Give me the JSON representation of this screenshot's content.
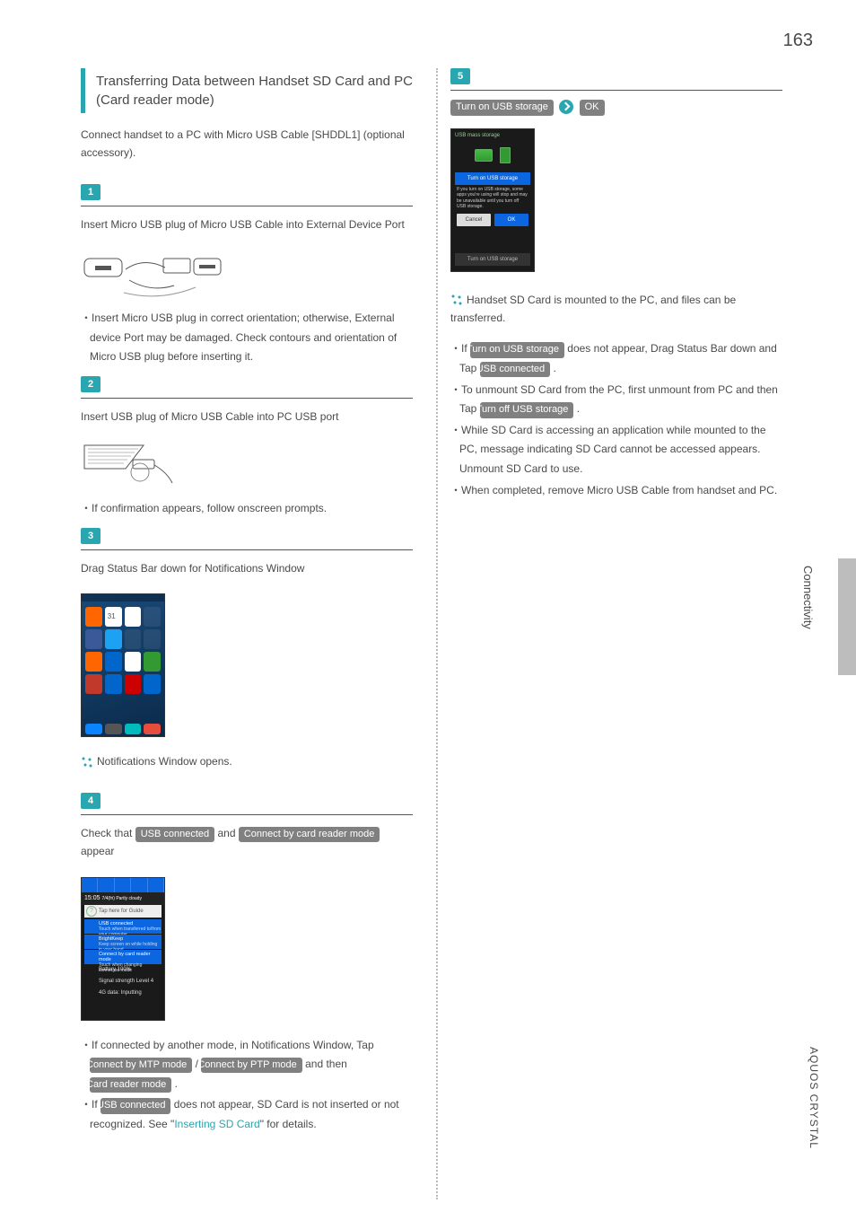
{
  "page_number": "163",
  "side_tab": "Connectivity",
  "footer_side": "AQUOS CRYSTAL",
  "left": {
    "title": "Transferring Data between Handset SD Card and PC (Card reader mode)",
    "intro": "Connect handset to a PC with Micro USB Cable [SHDDL1] (optional accessory).",
    "s1": {
      "num": "1",
      "text": "Insert Micro USB plug of Micro USB Cable into External Device Port",
      "note": "Insert Micro USB plug in correct orientation; otherwise, External device Port may be damaged. Check contours and orientation of Micro USB plug before inserting it."
    },
    "s2": {
      "num": "2",
      "text": "Insert USB plug of Micro USB Cable into PC USB port",
      "note": "If confirmation appears, follow onscreen prompts."
    },
    "s3": {
      "num": "3",
      "text": "Drag Status Bar down for Notifications Window",
      "result": "Notifications Window opens."
    },
    "s4": {
      "num": "4",
      "pre": "Check that ",
      "btn1": "USB connected",
      "mid": " and ",
      "btn2": "Connect by card reader mode",
      "post": " appear",
      "note1_a": "If connected by another mode, in Notifications Window, Tap ",
      "note1_btn1": "Connect by MTP mode",
      "note1_sep": " / ",
      "note1_btn2": "Connect by PTP mode",
      "note1_b": " and then ",
      "note1_btn3": "Card reader mode",
      "note1_c": " .",
      "note2_a": "If ",
      "note2_btn": "USB connected",
      "note2_b": " does not appear, SD Card is not inserted or not recognized. See \"",
      "note2_link": "Inserting SD Card",
      "note2_c": "\" for details."
    }
  },
  "right": {
    "s5": {
      "num": "5",
      "btn1": "Turn on USB storage",
      "btn2": "OK",
      "result": "Handset SD Card is mounted to the PC, and files can be transferred.",
      "n1_a": "If ",
      "n1_btn": "Turn on USB storage",
      "n1_b": " does not appear, Drag Status Bar down and Tap ",
      "n1_btn2": "USB connected",
      "n1_c": " .",
      "n2_a": "To unmount SD Card from the PC, first unmount from PC and then Tap ",
      "n2_btn": "Turn off USB storage",
      "n2_b": " .",
      "n3": "While SD Card is accessing an application while mounted to the PC, message indicating SD Card cannot be accessed appears. Unmount SD Card to use.",
      "n4": "When completed, remove Micro USB Cable from handset and PC."
    }
  },
  "mock": {
    "time": "15:05",
    "date": "7/4(fri) Partly cloudy",
    "guide": "Tap here for Guide",
    "usb_connected": "USB connected",
    "usb_sub": "Touch when transferred to/from your computer",
    "bright": "BrightKeep",
    "bright_sub": "Keep screen on while holding in your hand",
    "card_reader": "Connect by card reader mode",
    "card_sub": "Touch when changing connected mode",
    "battery": "Battery 100%",
    "signal": "Signal strength Level 4",
    "lte": "4G data: Inputting",
    "usb_title": "USB mass storage",
    "usb_bar": "Turn on USB storage",
    "usb_warn": "If you turn on USB storage, some apps you're using will stop and may be unavailable until you turn off USB storage.",
    "cancel": "Cancel",
    "ok": "OK",
    "usb_foot": "Turn on USB storage"
  }
}
